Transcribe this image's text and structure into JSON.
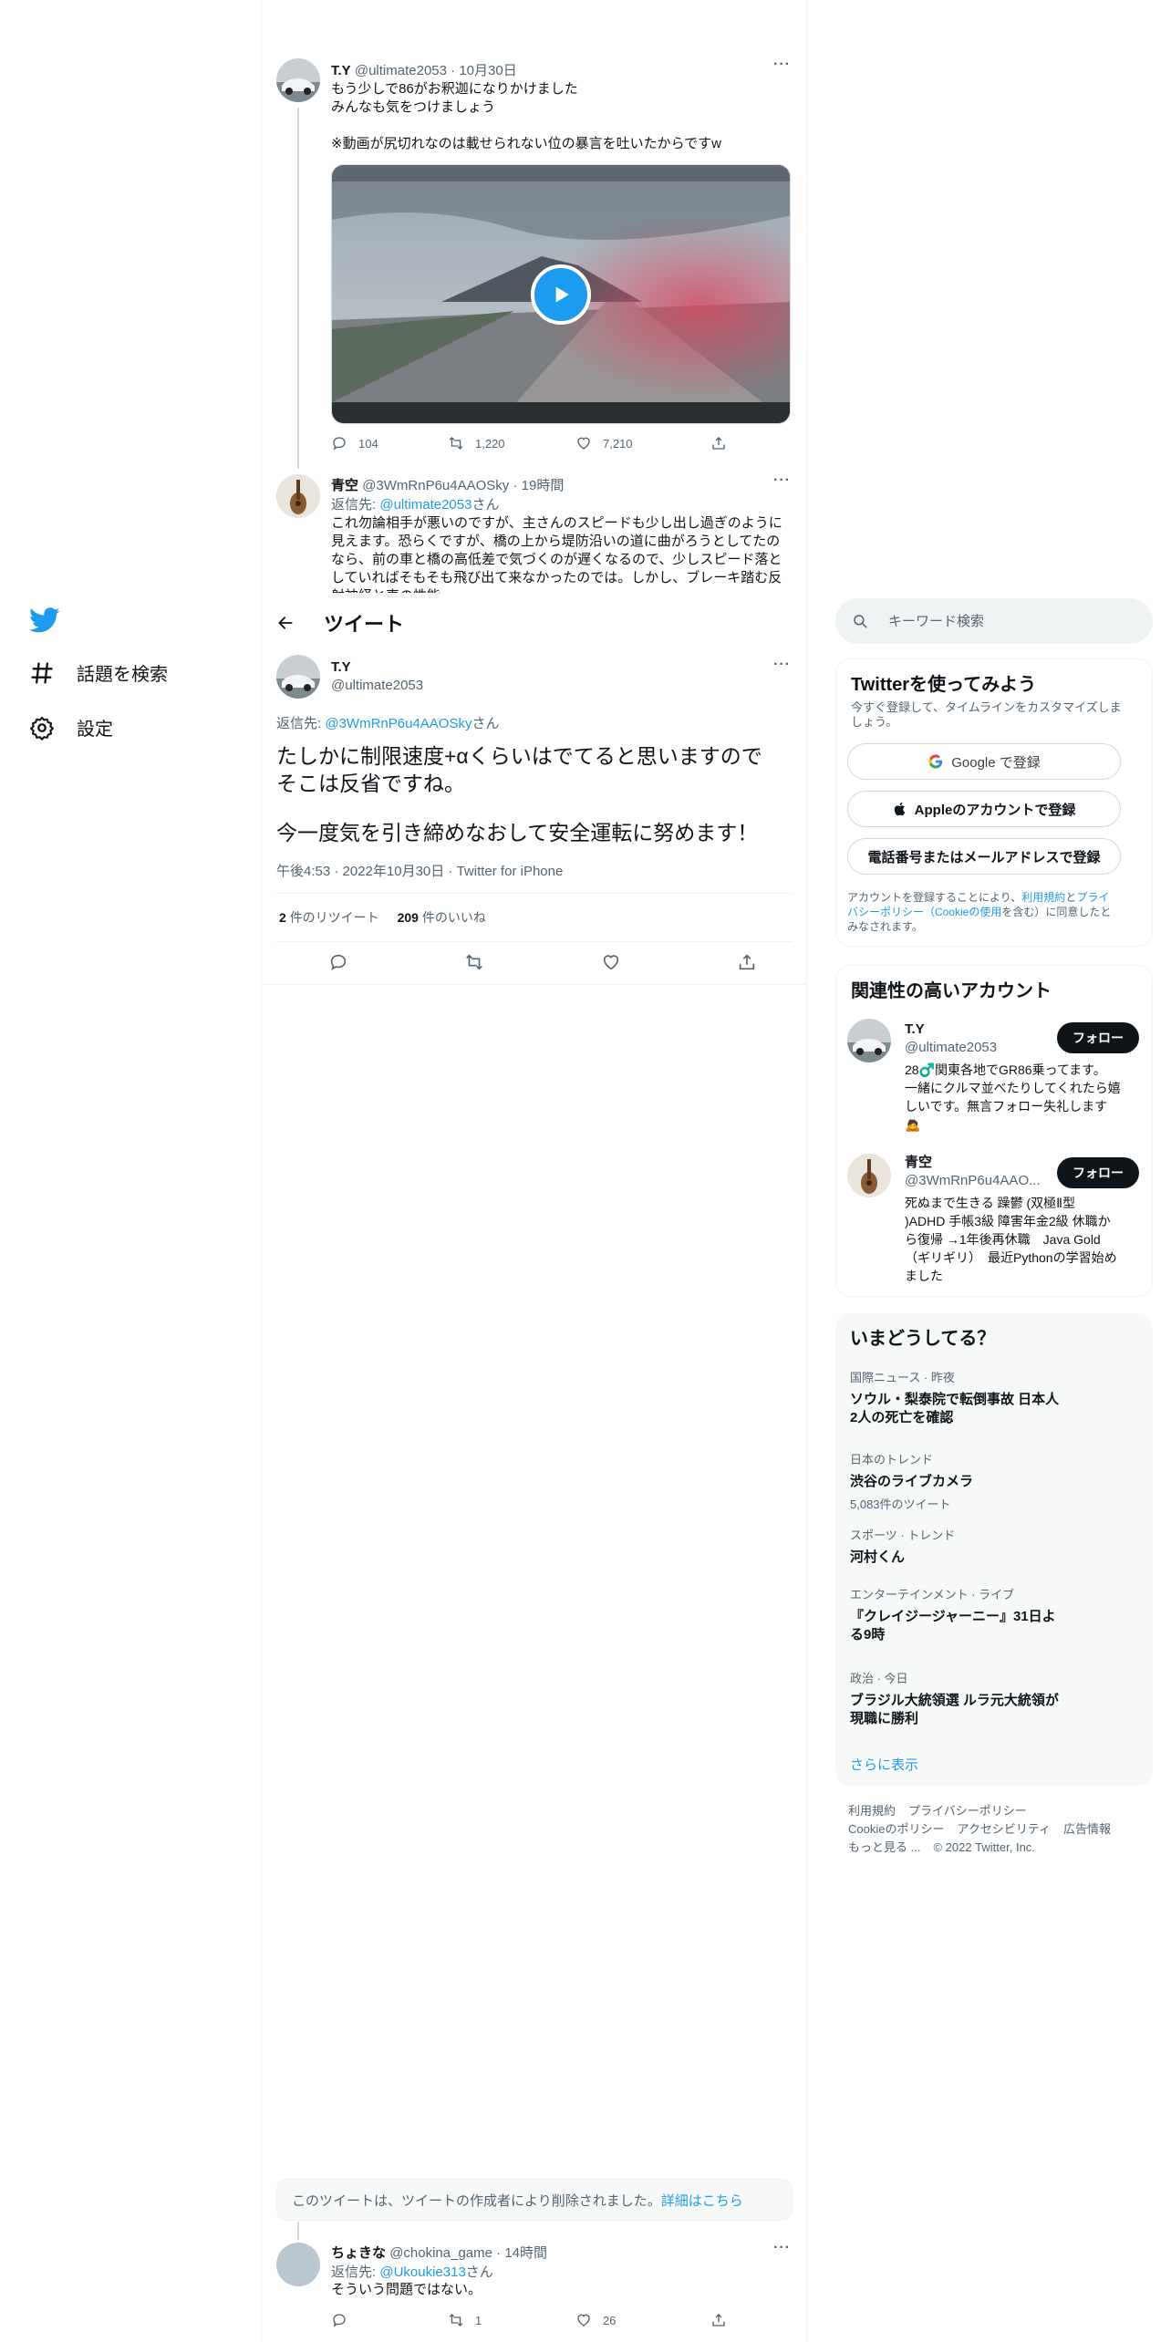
{
  "nav": {
    "items": [
      {
        "label": "話題を検索",
        "icon": "hashtag-icon"
      },
      {
        "label": "設定",
        "icon": "gear-icon"
      }
    ]
  },
  "header": {
    "title": "ツイート"
  },
  "thread_tweet": {
    "display_name": "T.Y",
    "handle": "@ultimate2053",
    "time": "10月30日",
    "lines": [
      "もう少しで86がお釈迦になりかけました",
      "みんなも気をつけましょう",
      "",
      "※動画が尻切れなのは載せられない位の暴言を吐いたからですw"
    ],
    "replies": "104",
    "retweets": "1,220",
    "likes": "7,210"
  },
  "reply_tweet": {
    "display_name": "青空",
    "handle": "@3WmRnP6u4AAOSky",
    "time": "19時間",
    "reply_to_prefix": "返信先: ",
    "reply_to": "@ultimate2053",
    "reply_to_suffix": "さん",
    "lines": [
      "これ勿論相手が悪いのですが、主さんのスピードも少し出し過ぎのように",
      "見えます。恐らくですが、橋の上から堤防沿いの道に曲がろうとしてたの",
      "なら、前の車と橋の高低差で気づくのが遅くなるので、少しスピード落と",
      "していればそもそも飛び出て来なかったのでは。しかし、ブレーキ踏む反",
      "射神経と車の性能"
    ]
  },
  "main_tweet": {
    "display_name": "T.Y",
    "handle": "@ultimate2053",
    "reply_to_prefix": "返信先: ",
    "reply_to": "@3WmRnP6u4AAOSky",
    "reply_to_suffix": "さん",
    "line1": "たしかに制限速度+αくらいはでてると思いますので",
    "line2": "そこは反省ですね。",
    "line3": "今一度気を引き締めなおして安全運転に努めます！",
    "timestamp": "午後4:53 · 2022年10月30日 · Twitter for iPhone",
    "retweet_count": "2",
    "retweet_label": "件のリツイート",
    "like_count": "209",
    "like_label": "件のいいね"
  },
  "deleted_notice": {
    "text": "このツイートは、ツイートの作成者により削除されました。",
    "link": "詳細はこちら"
  },
  "bottom_tweet": {
    "display_name": "ちょきな",
    "handle": "@chokina_game",
    "time": "14時間",
    "reply_to_prefix": "返信先: ",
    "reply_to": "@Ukoukie313",
    "reply_to_suffix": "さん",
    "text": "そういう問題ではない。",
    "retweets": "1",
    "likes": "26"
  },
  "search": {
    "placeholder": "キーワード検索"
  },
  "signup": {
    "title": "Twitterを使ってみよう",
    "subtitle_1": "今すぐ登録して、タイムラインをカスタマイズしま",
    "subtitle_2": "しょう。",
    "google": "Google で登録",
    "apple": "Appleのアカウントで登録",
    "phone": "電話番号またはメールアドレスで登録",
    "legal_1": "アカウントを登録することにより、",
    "legal_terms": "利用規約",
    "legal_and": "と",
    "legal_privacy": "プライ",
    "legal_privacy_2": "バシーポリシー（Cookieの使用",
    "legal_2": "を含む）に同意したと",
    "legal_3": "みなされます。"
  },
  "related": {
    "title": "関連性の高いアカウント",
    "follow_label": "フォロー",
    "accounts": [
      {
        "name": "T.Y",
        "handle": "@ultimate2053",
        "bio": [
          "28♂️関東各地でGR86乗ってます。",
          "一緒にクルマ並べたりしてくれたら嬉",
          "しいです。無言フォロー失礼します",
          "🙇"
        ]
      },
      {
        "name": "青空",
        "handle": "@3WmRnP6u4AAO...",
        "bio": [
          "死ぬまで生きる 躁鬱 (双極Ⅱ型",
          ")ADHD 手帳3級 障害年金2級 休職か",
          "ら復帰 →1年後再休職　Java Gold",
          "（ギリギリ）　最近Pythonの学習始め",
          "ました"
        ]
      }
    ]
  },
  "trends": {
    "title": "いまどうしてる？",
    "items": [
      {
        "meta": "国際ニュース · 昨夜",
        "title_1": "ソウル・梨泰院で転倒事故 日本人",
        "title_2": "2人の死亡を確認",
        "count": ""
      },
      {
        "meta": "日本のトレンド",
        "title_1": "渋谷のライブカメラ",
        "title_2": "",
        "count": "5,083件のツイート"
      },
      {
        "meta": "スポーツ · トレンド",
        "title_1": "河村くん",
        "title_2": "",
        "count": ""
      },
      {
        "meta": "エンターテインメント · ライブ",
        "title_1": "『クレイジージャーニー』31日よ",
        "title_2": "る9時",
        "count": ""
      },
      {
        "meta": "政治 · 今日",
        "title_1": "ブラジル大統領選 ルラ元大統領が",
        "title_2": "現職に勝利",
        "count": ""
      }
    ],
    "show_more": "さらに表示"
  },
  "footer": {
    "row1": [
      "利用規約",
      "プライバシーポリシー"
    ],
    "row2": [
      "Cookieのポリシー",
      "アクセシビリティ",
      "広告情報"
    ],
    "row3": [
      "もっと見る ...",
      "© 2022 Twitter, Inc."
    ]
  },
  "colors": {
    "accent": "#1d9bf0",
    "text": "#0f1419",
    "muted": "#536471",
    "border": "#eff3f4"
  }
}
